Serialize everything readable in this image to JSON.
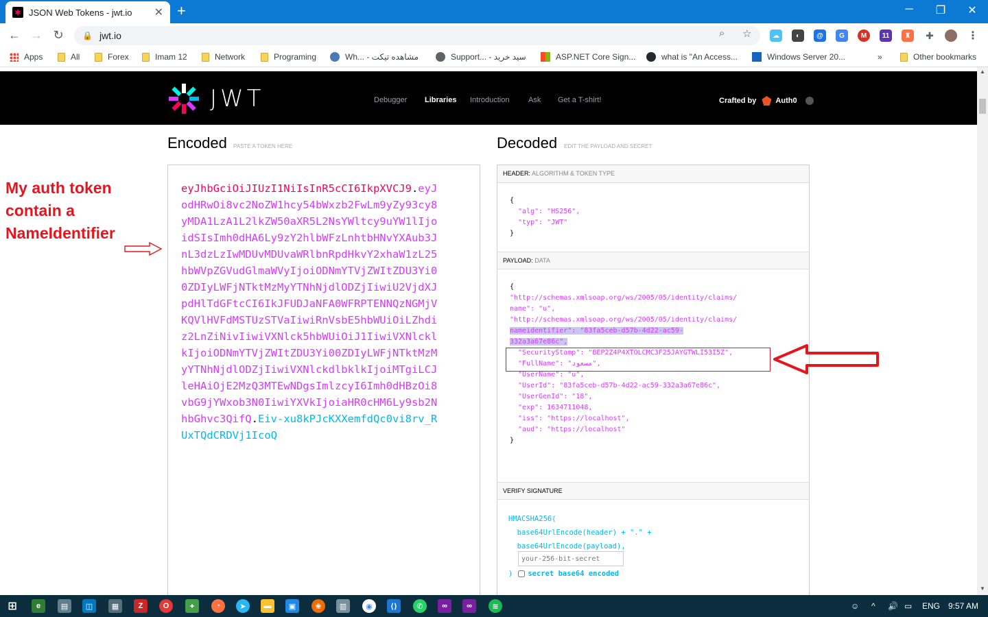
{
  "browser": {
    "tab_title": "JSON Web Tokens - jwt.io",
    "url": "jwt.io",
    "bookmarks": [
      "Apps",
      "All",
      "Forex",
      "Imam 12",
      "Network",
      "Programing",
      "Wh... - مشاهده تیکت",
      "Support... - سید خرید",
      "ASP.NET Core Sign...",
      "what is \"An Access...",
      "Windows Server 20...",
      "Other bookmarks"
    ],
    "more": "»"
  },
  "site": {
    "logo": "JWT",
    "nav": [
      "Debugger",
      "Libraries",
      "Introduction",
      "Ask",
      "Get a T-shirt!"
    ],
    "crafted_by": "Crafted by",
    "auth0": "Auth0"
  },
  "encoded": {
    "title": "Encoded",
    "subtitle": "PASTE A TOKEN HERE",
    "header_part": "eyJhbGciOiJIUzI1NiIsInR5cCI6IkpXVCJ9",
    "payload_part": "eyJodHRwOi8vc2NoZW1hcy54bWxzb2FwLm9yZy93cy8yMDA1LzA1L2lkZW50aXR5L2NsYWltcy9uYW1lIjoidSIsImh0dHA6Ly9zY2hlbWFzLnhtbHNvYXAub3JnL3dzLzIwMDUvMDUvaWRlbnRpdHkvY2xhaW1zL25hbWVpZGVudGlmaWVyIjoiODNmYTVjZWItZDU3Yi00ZDIyLWFjNTktMzMyYTNhNjdlODZjIiwiU2VjdXJpdHlTdGFtcCI6IkJFUDJaNFA0WFRPTENNQzNGMjVKQVlHVFdMSTUzSTVaIiwiRnVsbE5hbWUiOiLZhdiz2LnZiNivIiwiVXNlck5hbWUiOiJ1IiwiVXNlcklkIjoiODNmYTVjZWItZDU3Yi00ZDIyLWFjNTktMzMyYTNhNjdlODZjIiwiVXNlckdlbklkIjoiMTgiLCJleHAiOjE2MzQ3MTEwNDgsImlzcyI6Imh0dHBzOi8vbG9jYWxob3N0IiwiYXVkIjoiaHR0cHM6Ly9sb2NhbGhvc3QifQ",
    "signature_part": "Eiv-xu8kPJcKXXemfdQc0vi8rv_RUxTQdCRDVj1IcoQ"
  },
  "decoded": {
    "title": "Decoded",
    "subtitle": "EDIT THE PAYLOAD AND SECRET",
    "header_label": "HEADER:",
    "header_sub": "ALGORITHM & TOKEN TYPE",
    "header_lines": [
      "{",
      "  \"alg\": \"HS256\",",
      "  \"typ\": \"JWT\"",
      "}"
    ],
    "payload_label": "PAYLOAD:",
    "payload_sub": "DATA",
    "payload_lines": [
      "{",
      "",
      "\"http://schemas.xmlsoap.org/ws/2005/05/identity/claims/",
      "name\": \"u\",",
      "",
      "\"http://schemas.xmlsoap.org/ws/2005/05/identity/claims/",
      "nameidentifier\": \"83fa5ceb-d57b-4d22-ac59-",
      "332a3a67e86c\",",
      "  \"SecurityStamp\": \"BEP2Z4P4XTOLCMC3F25JAYGTWLI53I5Z\",",
      "  \"FullName\": \"مسعود\",",
      "  \"UserName\": \"u\",",
      "  \"UserId\": \"83fa5ceb-d57b-4d22-ac59-332a3a67e86c\",",
      "  \"UserGenId\": \"18\",",
      "  \"exp\": 1634711048,",
      "  \"iss\": \"https://localhost\",",
      "  \"aud\": \"https://localhost\"",
      "}"
    ],
    "verify_label": "VERIFY SIGNATURE",
    "verify_lines": [
      "HMACSHA256(",
      "  base64UrlEncode(header) + \".\" +",
      "  base64UrlEncode(payload),"
    ],
    "secret_placeholder": "your-256-bit-secret",
    "close_paren": ")",
    "base64_label": "secret base64 encoded"
  },
  "annotation": {
    "note_lines": [
      "My auth token",
      "contain a",
      "NameIdentifier"
    ],
    "color": "#e4161d"
  },
  "taskbar": {
    "lang": "ENG",
    "time": "9:57 AM"
  }
}
